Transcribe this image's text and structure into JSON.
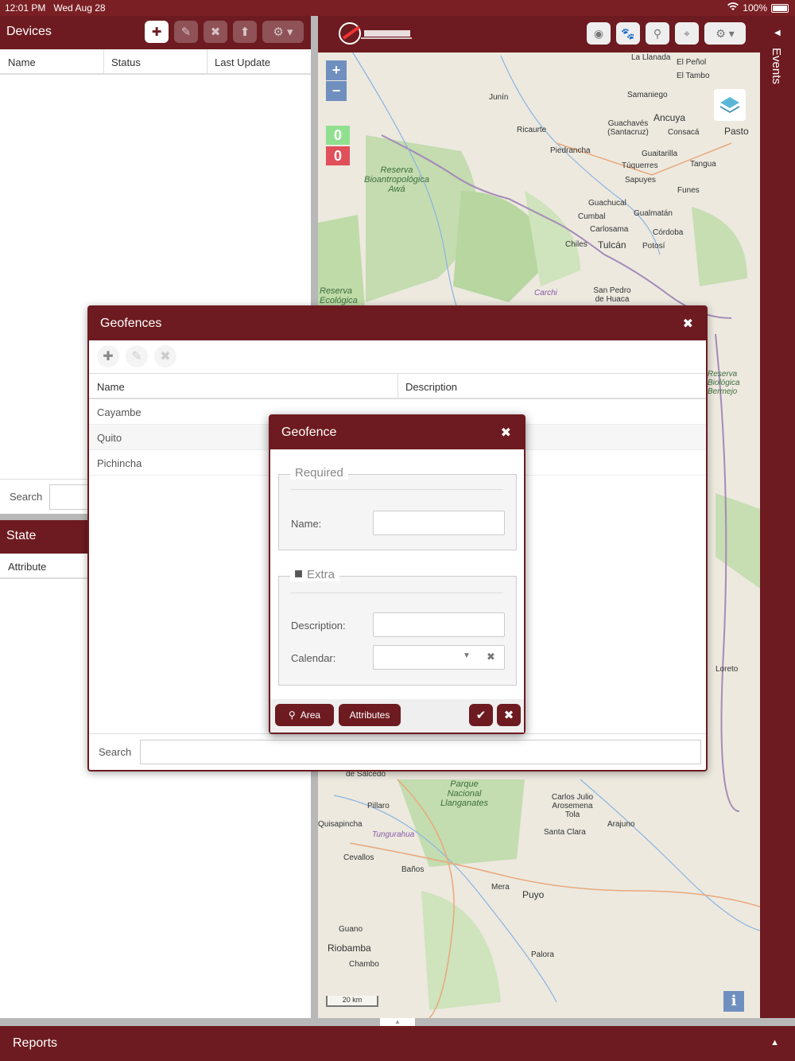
{
  "status_bar": {
    "time": "12:01 PM",
    "date": "Wed Aug 28",
    "battery": "100%"
  },
  "devices": {
    "title": "Devices",
    "columns": [
      "Name",
      "Status",
      "Last Update"
    ],
    "search_label": "Search"
  },
  "state": {
    "title": "State",
    "column": "Attribute"
  },
  "map": {
    "zoom_in": "+",
    "zoom_out": "−",
    "counter_online": "0",
    "counter_offline": "0",
    "scale": "20 km",
    "info": "i",
    "labels": [
      "La Llanada",
      "El Peñol",
      "El Tambo",
      "Junín",
      "Samaniego",
      "Ancuya",
      "Guachavés (Santacruz)",
      "Consacá",
      "Pasto",
      "Ricaurte",
      "Piedrancha",
      "Guaitarilla",
      "Túquerres",
      "Tangua",
      "Sapuyes",
      "Funes",
      "Guachucal",
      "Cumbal",
      "Gualmatán",
      "Carlosama",
      "Córdoba",
      "Chiles",
      "Tulcán",
      "Potosí",
      "Carchi",
      "San Pedro de Huaca",
      "Loreto",
      "Pillaro",
      "Quisapincha",
      "Tungurahua",
      "Carlos Julio Arosemena Tola",
      "Santa Clara",
      "Arajuno",
      "Cevallos",
      "Baños",
      "Mera",
      "Puyo",
      "Guano",
      "Riobamba",
      "Chambo",
      "Palora",
      "de Salcedo"
    ],
    "parks": [
      "Reserva Bioantropológica Awá",
      "Reserva Ecológica",
      "Parque Nacional Llanganates",
      "Reserva Biológica Bermejo"
    ]
  },
  "events": {
    "title": "Events"
  },
  "reports": {
    "title": "Reports"
  },
  "geofences": {
    "title": "Geofences",
    "columns": [
      "Name",
      "Description"
    ],
    "rows": [
      "Cayambe",
      "Quito",
      "Pichincha"
    ],
    "search_label": "Search"
  },
  "geofence_dialog": {
    "title": "Geofence",
    "required_legend": "Required",
    "name_label": "Name:",
    "extra_legend": "Extra",
    "description_label": "Description:",
    "calendar_label": "Calendar:",
    "area_button": "Area",
    "attributes_button": "Attributes"
  },
  "colors": {
    "brand": "#6d1b20",
    "map_bg": "#ede9df",
    "zoom": "#6f8fbf"
  }
}
